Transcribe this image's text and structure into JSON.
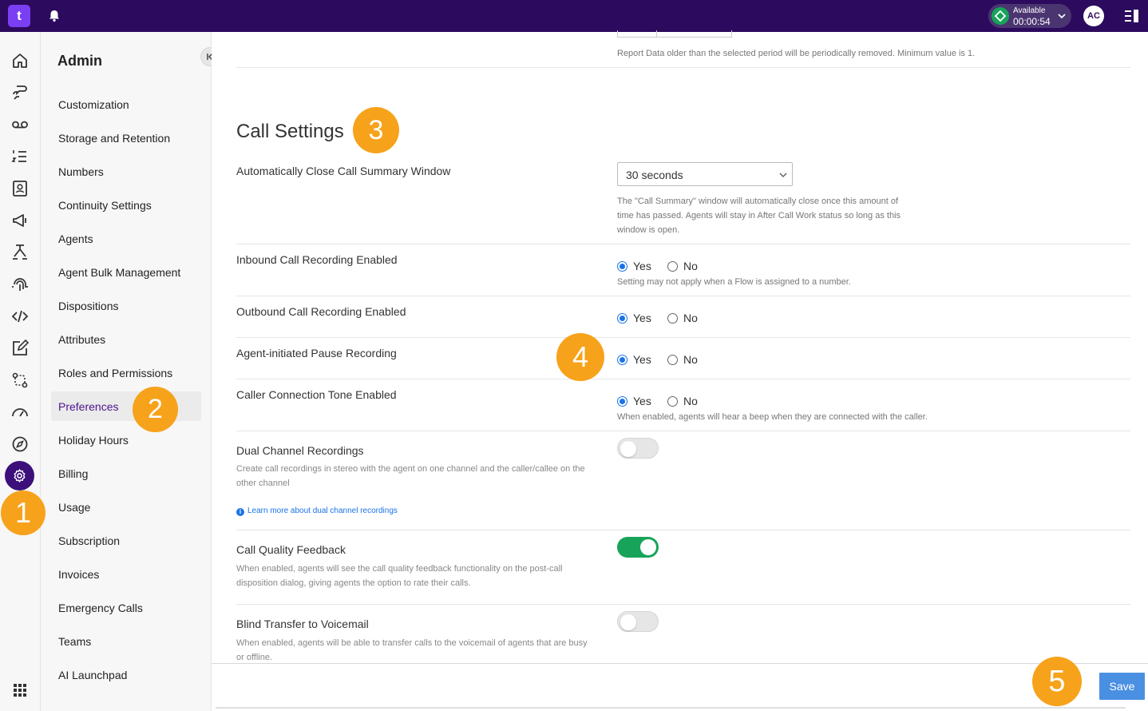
{
  "topbar": {
    "logo_text": "t",
    "status_label": "Available",
    "status_time": "00:00:54",
    "avatar_initials": "AC"
  },
  "sidebar": {
    "title": "Admin",
    "items": [
      {
        "label": "Customization"
      },
      {
        "label": "Storage and Retention"
      },
      {
        "label": "Numbers"
      },
      {
        "label": "Continuity Settings"
      },
      {
        "label": "Agents"
      },
      {
        "label": "Agent Bulk Management"
      },
      {
        "label": "Dispositions"
      },
      {
        "label": "Attributes"
      },
      {
        "label": "Roles and Permissions"
      },
      {
        "label": "Preferences",
        "active": true
      },
      {
        "label": "Holiday Hours"
      },
      {
        "label": "Billing"
      },
      {
        "label": "Usage"
      },
      {
        "label": "Subscription"
      },
      {
        "label": "Invoices"
      },
      {
        "label": "Emergency Calls"
      },
      {
        "label": "Teams"
      },
      {
        "label": "AI Launchpad"
      }
    ]
  },
  "main": {
    "retention_help": "Report Data older than the selected period will be periodically removed. Minimum value is 1.",
    "section_title": "Call Settings",
    "auto_close": {
      "label": "Automatically Close Call Summary Window",
      "value": "30 seconds",
      "help_1": "The \"Call Summary\" window will automatically close once this amount of",
      "help_2": "time has passed. Agents will stay in After Call Work status so long as this",
      "help_3": "window is open."
    },
    "radio_yes": "Yes",
    "radio_no": "No",
    "inbound": {
      "label": "Inbound Call Recording Enabled",
      "selected": "Yes",
      "help": "Setting may not apply when a Flow is assigned to a number."
    },
    "outbound": {
      "label": "Outbound Call Recording Enabled",
      "selected": "Yes"
    },
    "pause": {
      "label": "Agent-initiated Pause Recording",
      "selected": "Yes"
    },
    "tone": {
      "label": "Caller Connection Tone Enabled",
      "selected": "Yes",
      "help": "When enabled, agents will hear a beep when they are connected with the caller."
    },
    "dual": {
      "label": "Dual Channel Recordings",
      "desc_1": "Create call recordings in stereo with the agent on one channel and the caller/callee on the",
      "desc_2": "other channel",
      "link": "Learn more about dual channel recordings",
      "enabled": false
    },
    "quality": {
      "label": "Call Quality Feedback",
      "desc_1": "When enabled, agents will see the call quality feedback functionality on the post-call",
      "desc_2": "disposition dialog, giving agents the option to rate their calls.",
      "enabled": true
    },
    "blind": {
      "label": "Blind Transfer to Voicemail",
      "desc_1": "When enabled, agents will be able to transfer calls to the voicemail of agents that are busy",
      "desc_2": "or offline.",
      "enabled": false
    }
  },
  "footer": {
    "save_label": "Save"
  },
  "callouts": [
    "1",
    "2",
    "3",
    "4",
    "5"
  ],
  "colors": {
    "topbar": "#2c0a5e",
    "accent": "#4a148c",
    "callout": "#f7a21b",
    "toggle_on": "#17a45a",
    "save": "#4a90e2"
  }
}
